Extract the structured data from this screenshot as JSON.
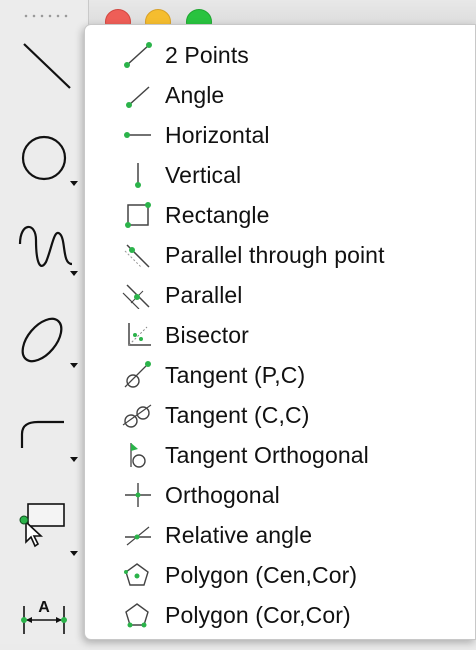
{
  "menu": {
    "items": [
      {
        "label": "2 Points",
        "icon": "two-points-line-icon"
      },
      {
        "label": "Angle",
        "icon": "angle-line-icon"
      },
      {
        "label": "Horizontal",
        "icon": "horizontal-line-icon"
      },
      {
        "label": "Vertical",
        "icon": "vertical-line-icon"
      },
      {
        "label": "Rectangle",
        "icon": "rectangle-icon"
      },
      {
        "label": "Parallel through point",
        "icon": "parallel-through-point-icon"
      },
      {
        "label": "Parallel",
        "icon": "parallel-icon"
      },
      {
        "label": "Bisector",
        "icon": "bisector-icon"
      },
      {
        "label": "Tangent (P,C)",
        "icon": "tangent-point-circle-icon"
      },
      {
        "label": "Tangent (C,C)",
        "icon": "tangent-circle-circle-icon"
      },
      {
        "label": "Tangent Orthogonal",
        "icon": "tangent-orthogonal-icon"
      },
      {
        "label": "Orthogonal",
        "icon": "orthogonal-icon"
      },
      {
        "label": "Relative angle",
        "icon": "relative-angle-icon"
      },
      {
        "label": "Polygon (Cen,Cor)",
        "icon": "polygon-center-corner-icon"
      },
      {
        "label": "Polygon (Cor,Cor)",
        "icon": "polygon-corner-corner-icon"
      }
    ]
  },
  "palette": {
    "tools": [
      "line-tool-icon",
      "circle-tool-icon",
      "spline-tool-icon",
      "ellipse-tool-icon",
      "arc-tool-icon",
      "selection-tool-icon",
      "dimension-tool-icon"
    ],
    "dimension_glyph": "A"
  },
  "colors": {
    "point_green": "#2bb34a",
    "traffic_close": "#ee5e57",
    "traffic_minimize": "#f5bd2f",
    "traffic_maximize": "#29c33f"
  }
}
